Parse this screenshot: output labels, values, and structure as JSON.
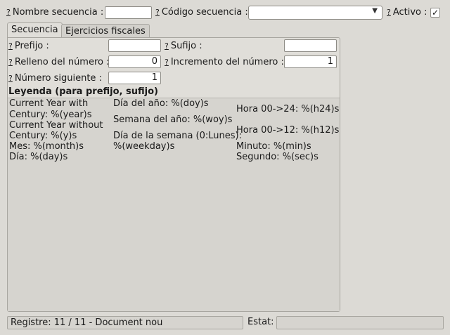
{
  "header": {
    "q": "?",
    "nombre_label": "Nombre secuencia :",
    "nombre_value": "",
    "codigo_label": "Código secuencia :",
    "codigo_value": "",
    "activo_label": "Activo :",
    "activo_checked": "✓"
  },
  "tabs": [
    {
      "label": "Secuencia"
    },
    {
      "label": "Ejercicios fiscales"
    }
  ],
  "form": {
    "prefijo_label": "Prefijo :",
    "prefijo_value": "",
    "sufijo_label": "Sufijo :",
    "sufijo_value": "",
    "relleno_label": "Relleno del número :",
    "relleno_value": "0",
    "incremento_label": "Incremento del número :",
    "incremento_value": "1",
    "siguiente_label": "Número siguiente :",
    "siguiente_value": "1"
  },
  "legend": {
    "title": "Leyenda (para prefijo, sufijo)",
    "col1": [
      "Current Year with",
      "Century: %(year)s",
      "Current Year without",
      "Century: %(y)s",
      "Mes: %(month)s",
      "Día: %(day)s"
    ],
    "col2": [
      "Día del año: %(doy)s",
      "Semana del año: %(woy)s",
      "Día de la semana (0:Lunes):",
      "%(weekday)s"
    ],
    "col3": [
      "Hora 00->24: %(h24)s",
      "Hora 00->12: %(h12)s",
      "Minuto: %(min)s",
      "Segundo: %(sec)s"
    ]
  },
  "status": {
    "registre": "Registre: 11 / 11 - Document nou",
    "estat_label": "Estat:",
    "estat_value": ""
  }
}
